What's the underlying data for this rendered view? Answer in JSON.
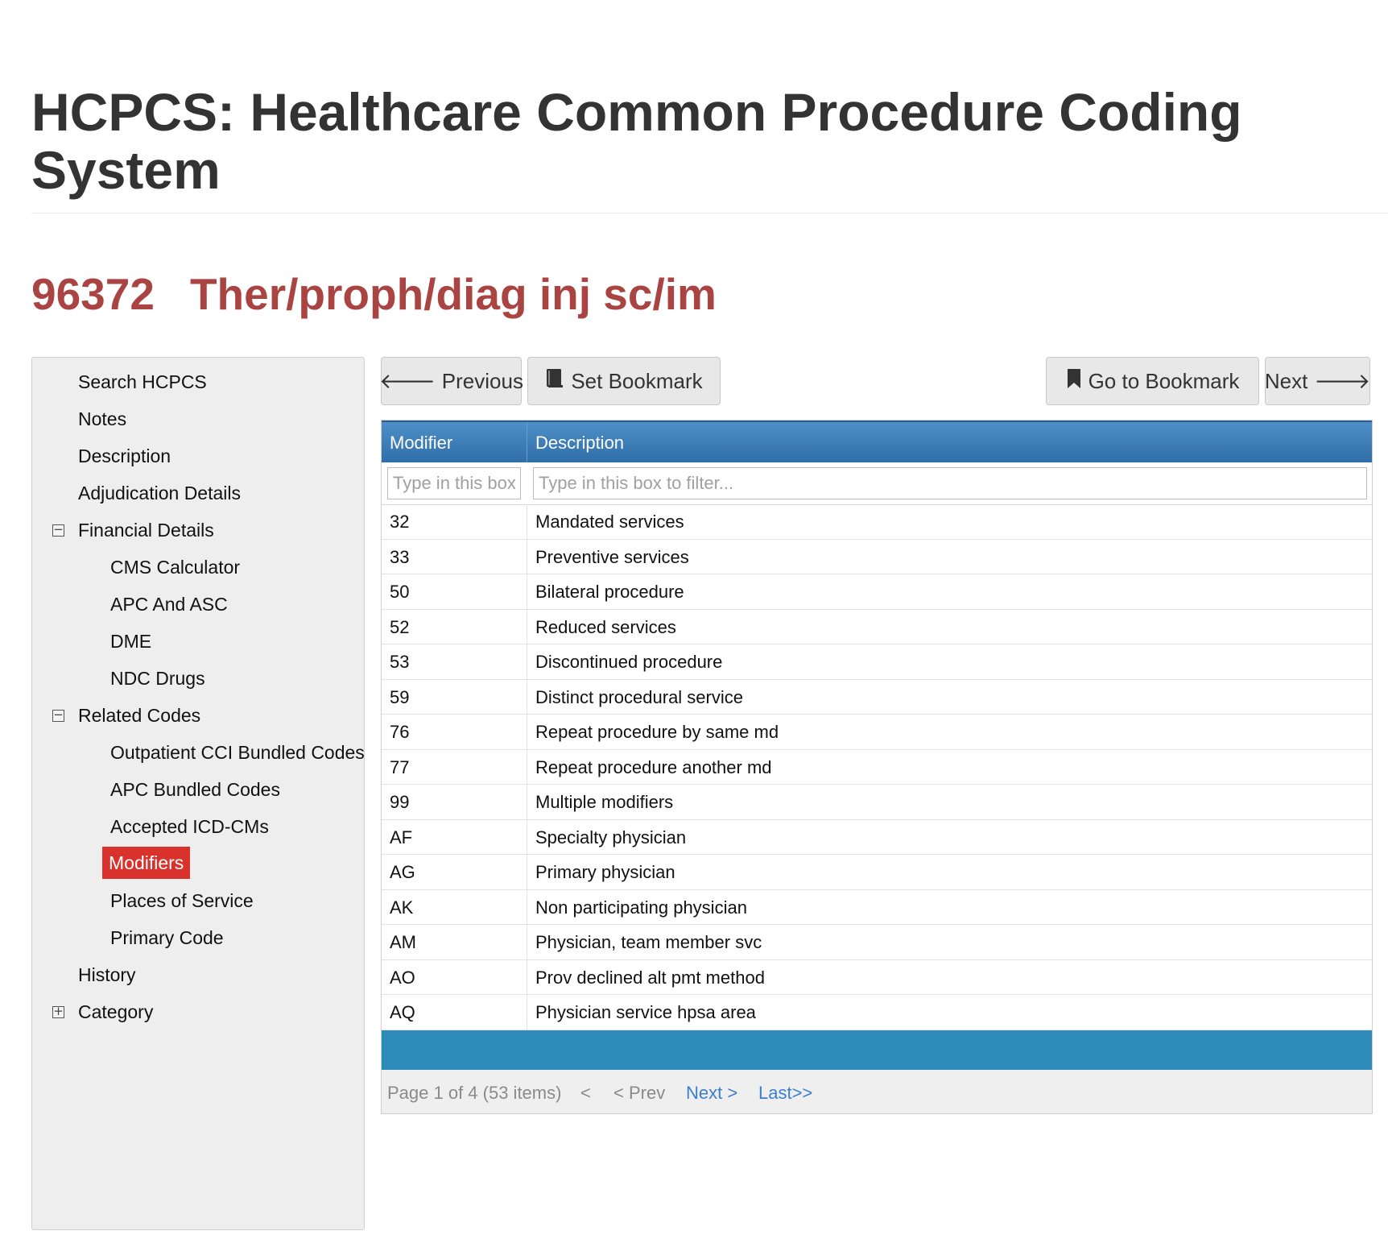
{
  "page": {
    "title": "HCPCS: Healthcare Common Procedure Coding System",
    "code": "96372",
    "code_description": "Ther/proph/diag inj sc/im"
  },
  "sidebar": {
    "items": [
      {
        "label": "Search HCPCS"
      },
      {
        "label": "Notes"
      },
      {
        "label": "Description"
      },
      {
        "label": "Adjudication Details"
      },
      {
        "label": "Financial Details",
        "toggle": "⊟"
      },
      {
        "label": "CMS Calculator"
      },
      {
        "label": "APC And ASC"
      },
      {
        "label": "DME"
      },
      {
        "label": "NDC Drugs"
      },
      {
        "label": "Related Codes",
        "toggle": "⊟"
      },
      {
        "label": "Outpatient CCI Bundled Codes"
      },
      {
        "label": "APC Bundled Codes"
      },
      {
        "label": "Accepted ICD-CMs"
      },
      {
        "label": "Modifiers",
        "active": true
      },
      {
        "label": "Places of Service"
      },
      {
        "label": "Primary Code"
      },
      {
        "label": "History"
      },
      {
        "label": "Category",
        "toggle": "⊞"
      }
    ]
  },
  "toolbar": {
    "previous_label": "Previous",
    "set_bookmark_label": "Set Bookmark",
    "go_to_bookmark_label": "Go to Bookmark",
    "next_label": "Next",
    "icons": {
      "previous": "arrow-left-icon",
      "set_bookmark": "book-icon",
      "go_to_bookmark": "bookmark-icon",
      "next": "arrow-right-icon"
    }
  },
  "grid": {
    "columns": {
      "modifier": "Modifier",
      "description": "Description"
    },
    "filters": {
      "modifier_placeholder": "Type in this box",
      "description_placeholder": "Type in this box to filter..."
    },
    "rows": [
      {
        "modifier": "32",
        "description": "Mandated services"
      },
      {
        "modifier": "33",
        "description": "Preventive services"
      },
      {
        "modifier": "50",
        "description": "Bilateral procedure"
      },
      {
        "modifier": "52",
        "description": "Reduced services"
      },
      {
        "modifier": "53",
        "description": "Discontinued procedure"
      },
      {
        "modifier": "59",
        "description": "Distinct procedural service"
      },
      {
        "modifier": "76",
        "description": "Repeat procedure by same md"
      },
      {
        "modifier": "77",
        "description": "Repeat procedure another md"
      },
      {
        "modifier": "99",
        "description": "Multiple modifiers"
      },
      {
        "modifier": "AF",
        "description": "Specialty physician"
      },
      {
        "modifier": "AG",
        "description": "Primary physician"
      },
      {
        "modifier": "AK",
        "description": "Non participating physician"
      },
      {
        "modifier": "AM",
        "description": "Physician, team member svc"
      },
      {
        "modifier": "AO",
        "description": "Prov declined alt pmt method"
      },
      {
        "modifier": "AQ",
        "description": "Physician service hpsa area"
      }
    ],
    "pager": {
      "status": "Page 1 of 4 (53 items)",
      "first": "<",
      "prev": "< Prev",
      "next": "Next >",
      "last": "Last>>"
    }
  },
  "colors": {
    "accent_red": "#a94442",
    "active_nav": "#d9322d",
    "header_blue": "#3b7bb6",
    "footer_blue": "#2e8ab8",
    "link_blue": "#3a7fd0"
  }
}
